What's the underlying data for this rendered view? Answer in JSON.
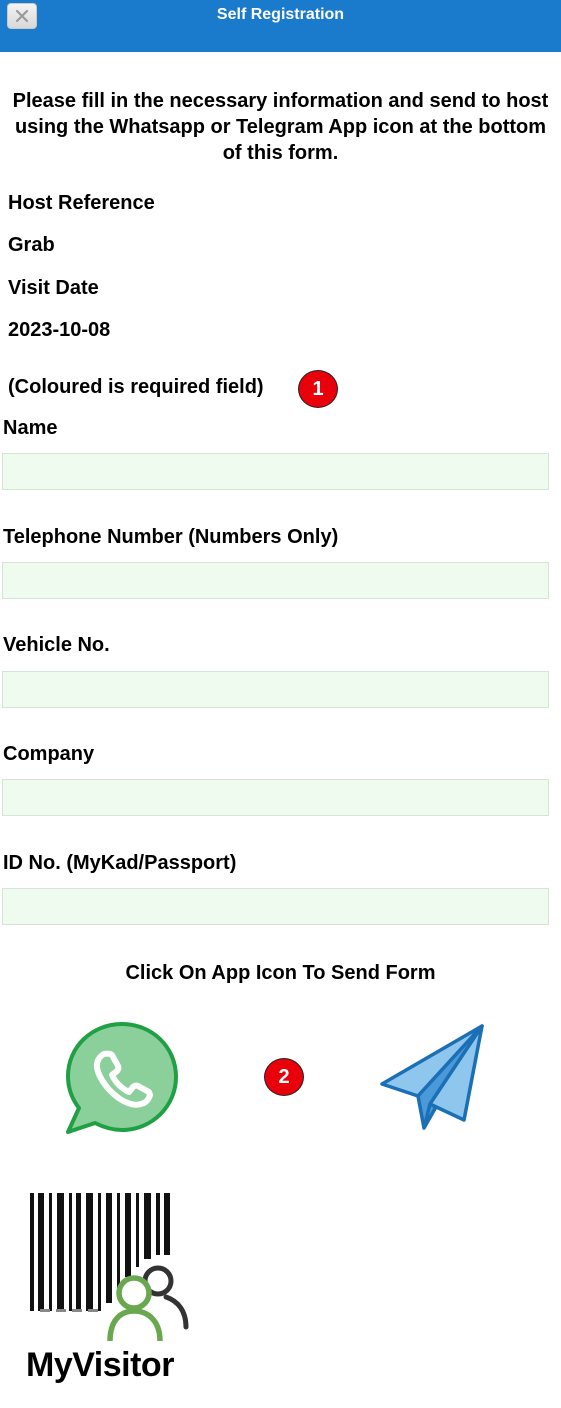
{
  "header": {
    "title": "Self Registration",
    "close_icon": "close-icon"
  },
  "intro_text": "Please fill in the necessary information and send to host using the Whatsapp or Telegram App icon at the bottom of this form.",
  "info": {
    "host_reference_label": "Host Reference",
    "host_reference_value": "Grab",
    "visit_date_label": "Visit Date",
    "visit_date_value": "2023-10-08"
  },
  "required_note": "(Coloured is required field)",
  "badges": {
    "one": "1",
    "two": "2"
  },
  "form": {
    "name_label": "Name",
    "name_value": "",
    "telephone_label": "Telephone Number (Numbers Only)",
    "telephone_value": "",
    "vehicle_label": "Vehicle No.",
    "vehicle_value": "",
    "company_label": "Company",
    "company_value": "",
    "id_label": "ID No. (MyKad/Passport)",
    "id_value": ""
  },
  "send": {
    "caption": "Click On App Icon To Send Form",
    "whatsapp_icon": "whatsapp-icon",
    "telegram_icon": "telegram-icon"
  },
  "branding": {
    "logo_text": "MyVisitor"
  },
  "colors": {
    "header_bg": "#1a7bcc",
    "required_field_bg": "#effbef",
    "badge_red": "#e8000b",
    "whatsapp_green": "#8bd09a",
    "telegram_blue": "#8fc6ee"
  }
}
